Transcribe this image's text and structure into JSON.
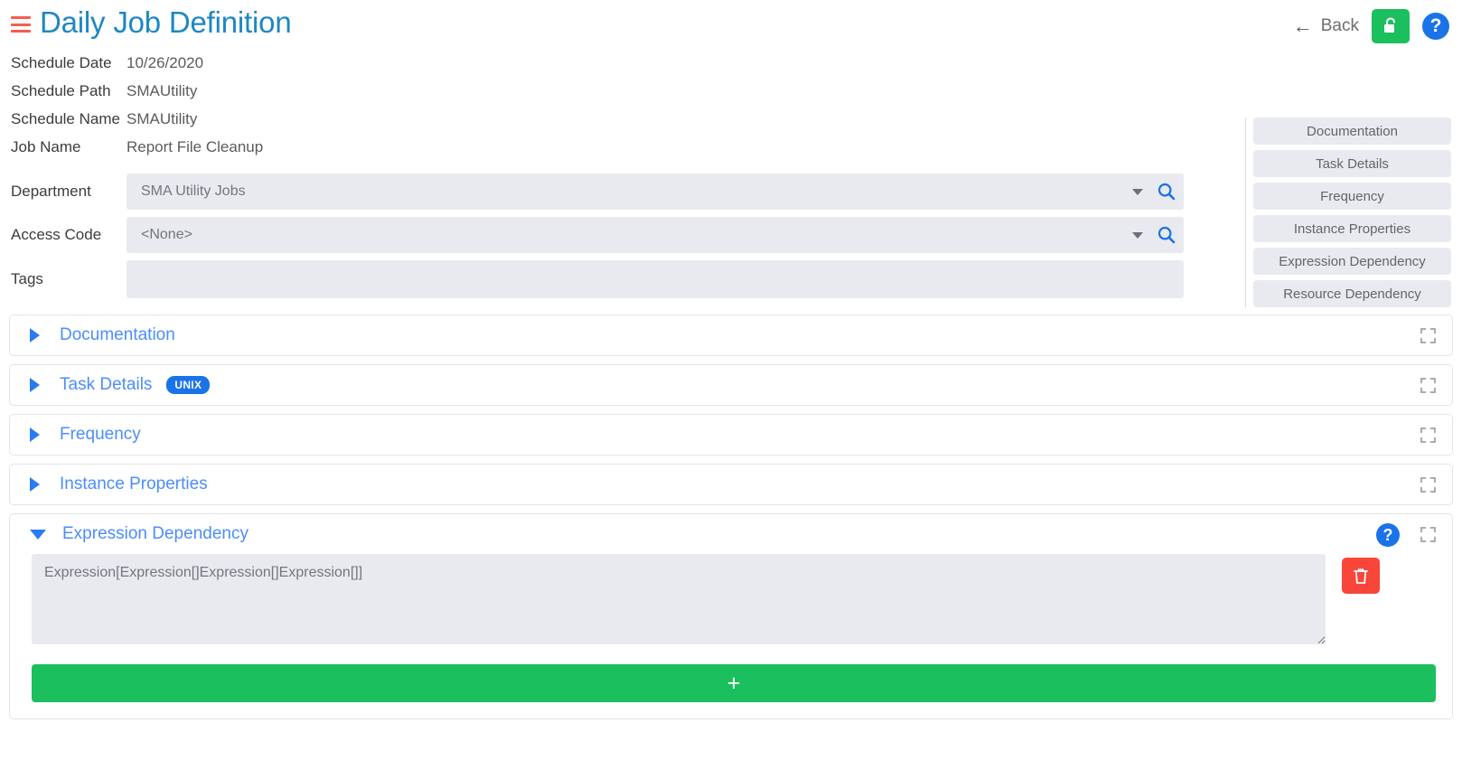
{
  "header": {
    "title": "Daily Job Definition",
    "menu_icon": "hamburger-icon",
    "back_label": "Back",
    "back_arrow": "←",
    "lock_icon": "unlock-icon",
    "help_label": "?",
    "accent_blue": "#1e87c4",
    "hamburger_color": "#fb5a4b",
    "green": "#1bbf5e",
    "help_blue": "#1a73e8"
  },
  "info": {
    "rows": [
      {
        "label": "Schedule Date",
        "value": "10/26/2020"
      },
      {
        "label": "Schedule Path",
        "value": "SMAUtility"
      },
      {
        "label": "Schedule Name",
        "value": "SMAUtility"
      },
      {
        "label": "Job Name",
        "value": "Report File Cleanup"
      }
    ]
  },
  "fields": {
    "department": {
      "label": "Department",
      "value": "SMA Utility Jobs",
      "caret_icon": "chevron-down-icon",
      "search_icon": "search-icon"
    },
    "access_code": {
      "label": "Access Code",
      "value": "<None>",
      "caret_icon": "chevron-down-icon",
      "search_icon": "search-icon"
    },
    "tags": {
      "label": "Tags",
      "value": ""
    }
  },
  "rightnav": {
    "items": [
      {
        "label": "Documentation"
      },
      {
        "label": "Task Details"
      },
      {
        "label": "Frequency"
      },
      {
        "label": "Instance Properties"
      },
      {
        "label": "Expression Dependency"
      },
      {
        "label": "Resource Dependency"
      }
    ]
  },
  "sections": [
    {
      "title": "Documentation",
      "expanded": false,
      "badge": "",
      "expand_icon": "fullscreen-icon"
    },
    {
      "title": "Task Details",
      "expanded": false,
      "badge": "UNIX",
      "expand_icon": "fullscreen-icon"
    },
    {
      "title": "Frequency",
      "expanded": false,
      "badge": "",
      "expand_icon": "fullscreen-icon"
    },
    {
      "title": "Instance Properties",
      "expanded": false,
      "badge": "",
      "expand_icon": "fullscreen-icon"
    },
    {
      "title": "Expression Dependency",
      "expanded": true,
      "badge": "",
      "expand_icon": "fullscreen-icon"
    }
  ],
  "expression_section": {
    "title": "Expression Dependency",
    "help_label": "?",
    "expression_value": "Expression[Expression[]Expression[]Expression[]]",
    "delete_icon": "trash-icon",
    "add_label": "+",
    "delete_color": "#f8463b",
    "add_color": "#1bbf5e"
  }
}
